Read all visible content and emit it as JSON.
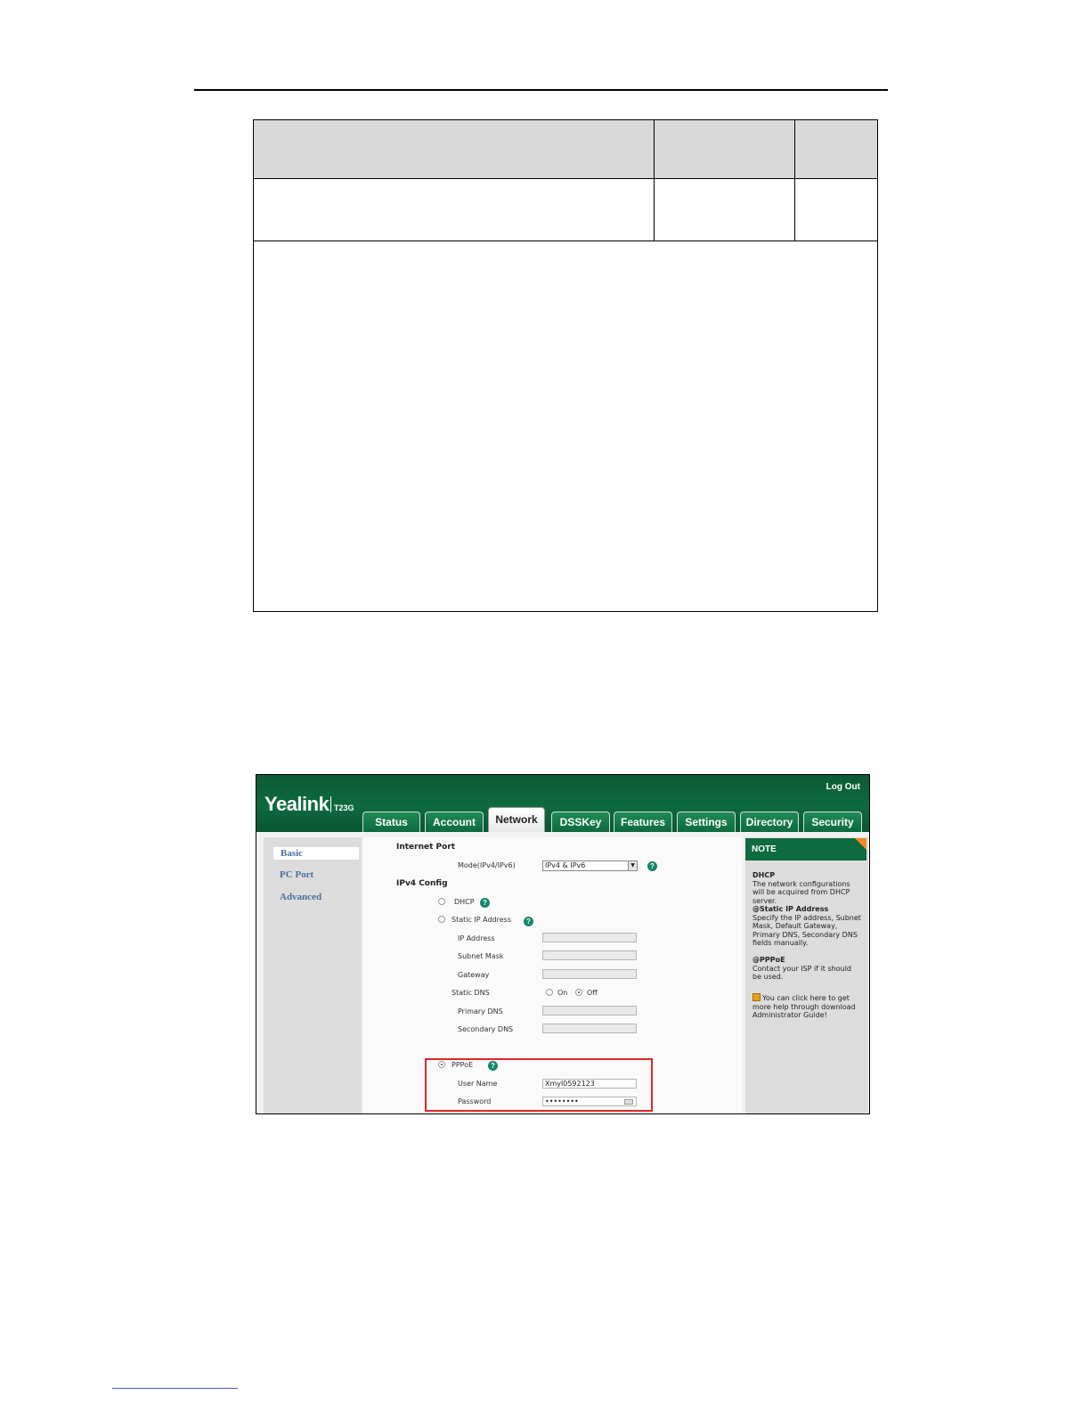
{
  "ui": {
    "logout": "Log Out",
    "brand": "Yealink",
    "model": "T23G",
    "tabs": [
      "Status",
      "Account",
      "Network",
      "DSSKey",
      "Features",
      "Settings",
      "Directory",
      "Security"
    ],
    "active_tab": "Network",
    "sidebar": [
      "Basic",
      "PC Port",
      "Advanced"
    ],
    "form": {
      "internet_port": "Internet Port",
      "mode_label": "Mode(IPv4/IPv6)",
      "mode_value": "IPv4 & IPv6",
      "ipv4_config": "IPv4 Config",
      "dhcp": "DHCP",
      "static_ip": "Static IP Address",
      "ip_address": "IP Address",
      "subnet_mask": "Subnet Mask",
      "gateway": "Gateway",
      "static_dns": "Static DNS",
      "on": "On",
      "off": "Off",
      "primary_dns": "Primary DNS",
      "secondary_dns": "Secondary DNS",
      "pppoe": "PPPoE",
      "user_name_label": "User Name",
      "user_name_value": "Xmyl0592123",
      "password_label": "Password",
      "password_value": "••••••••"
    },
    "note": {
      "title": "NOTE",
      "dhcp_title": "DHCP",
      "dhcp_text": "The network configurations will be acquired from DHCP server.",
      "static_title": "@Static IP Address",
      "static_text": "Specify the IP address, Subnet Mask, Default Gateway, Primary DNS, Secondary DNS fields manually.",
      "pppoe_title": "@PPPoE",
      "pppoe_text": "Contact your ISP if it should be used.",
      "help_text": "You can click here to get more help through download Administrator Guide!"
    },
    "help_glyph": "?"
  }
}
